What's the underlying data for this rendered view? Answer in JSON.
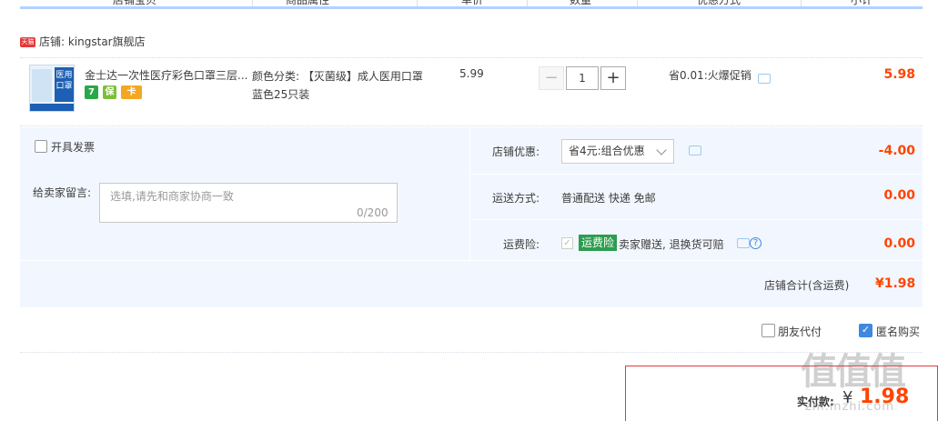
{
  "header_columns": [
    "店铺宝贝",
    "商品属性",
    "单价",
    "数量",
    "优惠方式",
    "小计"
  ],
  "shop": {
    "label": "店铺: kingstar旗舰店",
    "badge": "天猫"
  },
  "item": {
    "title": "金士达一次性医疗彩色口罩三层...",
    "thumb_text": "医用口罩",
    "spec": "颜色分类: 【灭菌级】成人医用口罩蓝色25只装",
    "unit_price": "5.99",
    "quantity": "1",
    "minus": "−",
    "plus": "+",
    "promo": "省0.01:火爆促销",
    "subtotal": "5.98",
    "service_icons": [
      "7",
      "保",
      "卡"
    ]
  },
  "invoice": {
    "label": "开具发票"
  },
  "message": {
    "label": "给卖家留言:",
    "placeholder": "选填,请先和商家协商一致",
    "count": "0/200"
  },
  "shop_coupon": {
    "label": "店铺优惠:",
    "selected": "省4元:组合优惠",
    "amount": "-4.00"
  },
  "shipping": {
    "label": "运送方式:",
    "value": "普通配送 快递 免邮",
    "amount": "0.00"
  },
  "insurance": {
    "label": "运费险:",
    "badge": "运费险",
    "text": "卖家赠送, 退换货可赔",
    "amount": "0.00",
    "help": "?"
  },
  "shop_total": {
    "label": "店铺合计(含运费)",
    "amount": "¥1.98"
  },
  "options": {
    "friend_pay": "朋友代付",
    "anonymous": "匿名购买"
  },
  "payment": {
    "label": "实付款:",
    "currency": "¥",
    "amount": "1.98"
  },
  "watermark": {
    "logo": "值值值",
    "site": "zhi.mzhi.com"
  },
  "colors": {
    "accent": "#ff4400",
    "brand_red": "#e4393c",
    "highlight_bg": "#f2f7ff",
    "blue": "#3f88e0",
    "green": "#2e9c4f"
  }
}
